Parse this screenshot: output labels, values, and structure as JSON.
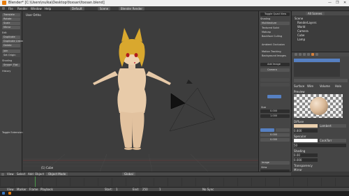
{
  "window": {
    "title": "Blender* [C:\\Users\\nulka\\Desktop\\foxsan\\foxsan.blend]",
    "controls": [
      "—",
      "❐",
      "✕"
    ]
  },
  "menu": {
    "items": [
      "File",
      "Render",
      "Window",
      "Help"
    ],
    "layout": "Default",
    "scene": "Scene",
    "engine": "Blender Render"
  },
  "toolshelf": {
    "buttons": [
      "Translate",
      "Rotate",
      "Scale",
      "Mirror",
      "Edit",
      "Duplicate",
      "Duplicate Linked",
      "Delete",
      "Join",
      "Set Origin",
      "Shading",
      "Smooth",
      "Flat",
      "History"
    ],
    "toggle_label": "Toggle Extension"
  },
  "viewport": {
    "label": "User Ortho",
    "footer_label": "(1) Cube"
  },
  "npanel": {
    "header_button": "Toggle Quad View",
    "sections": [
      "Shading",
      "Multitexture",
      "Textured Solid",
      "Matcap",
      "Backface Culling",
      "Ambient Occlusion",
      "Motion Tracking",
      "Background Images",
      "Add Image"
    ],
    "transform_mode": "Camera",
    "size_value": "0.000",
    "color_value": "1.000",
    "x_value": "0.000",
    "y_value": "0.000",
    "view_to_render": "Frame",
    "bottom_button": "Image",
    "view_label": "View",
    "apply_label": "Apply"
  },
  "outliner": {
    "header": "All Scenes",
    "items": [
      "Scene",
      "RenderLayers",
      "World",
      "Camera",
      "Cube",
      "Lamp"
    ]
  },
  "properties": {
    "material_tabs": [
      "Surface",
      "Wire",
      "Volume",
      "Halo"
    ],
    "preview_label": "Preview",
    "sections": [
      "Diffuse",
      "Specular",
      "Shading",
      "Transparency",
      "Mirror"
    ],
    "diffuse_shader": "Lambert",
    "specular_shader": "CookTorr",
    "intensity": "0.800",
    "hardness": "50",
    "emit": "0.00",
    "translucency": "0.000"
  },
  "view_header": {
    "items": [
      "View",
      "Select",
      "Add",
      "Object",
      "Object Mode",
      "Global"
    ]
  },
  "timeline_header": {
    "items": [
      "View",
      "Marker",
      "Frame",
      "Playback",
      "Start:",
      "1",
      "End:",
      "250",
      "1",
      "No Sync"
    ]
  },
  "colors": {
    "accent_orange": "#e87d0d",
    "selection_blue": "#5680c2",
    "viewport_bg": "#3d3d3d"
  }
}
